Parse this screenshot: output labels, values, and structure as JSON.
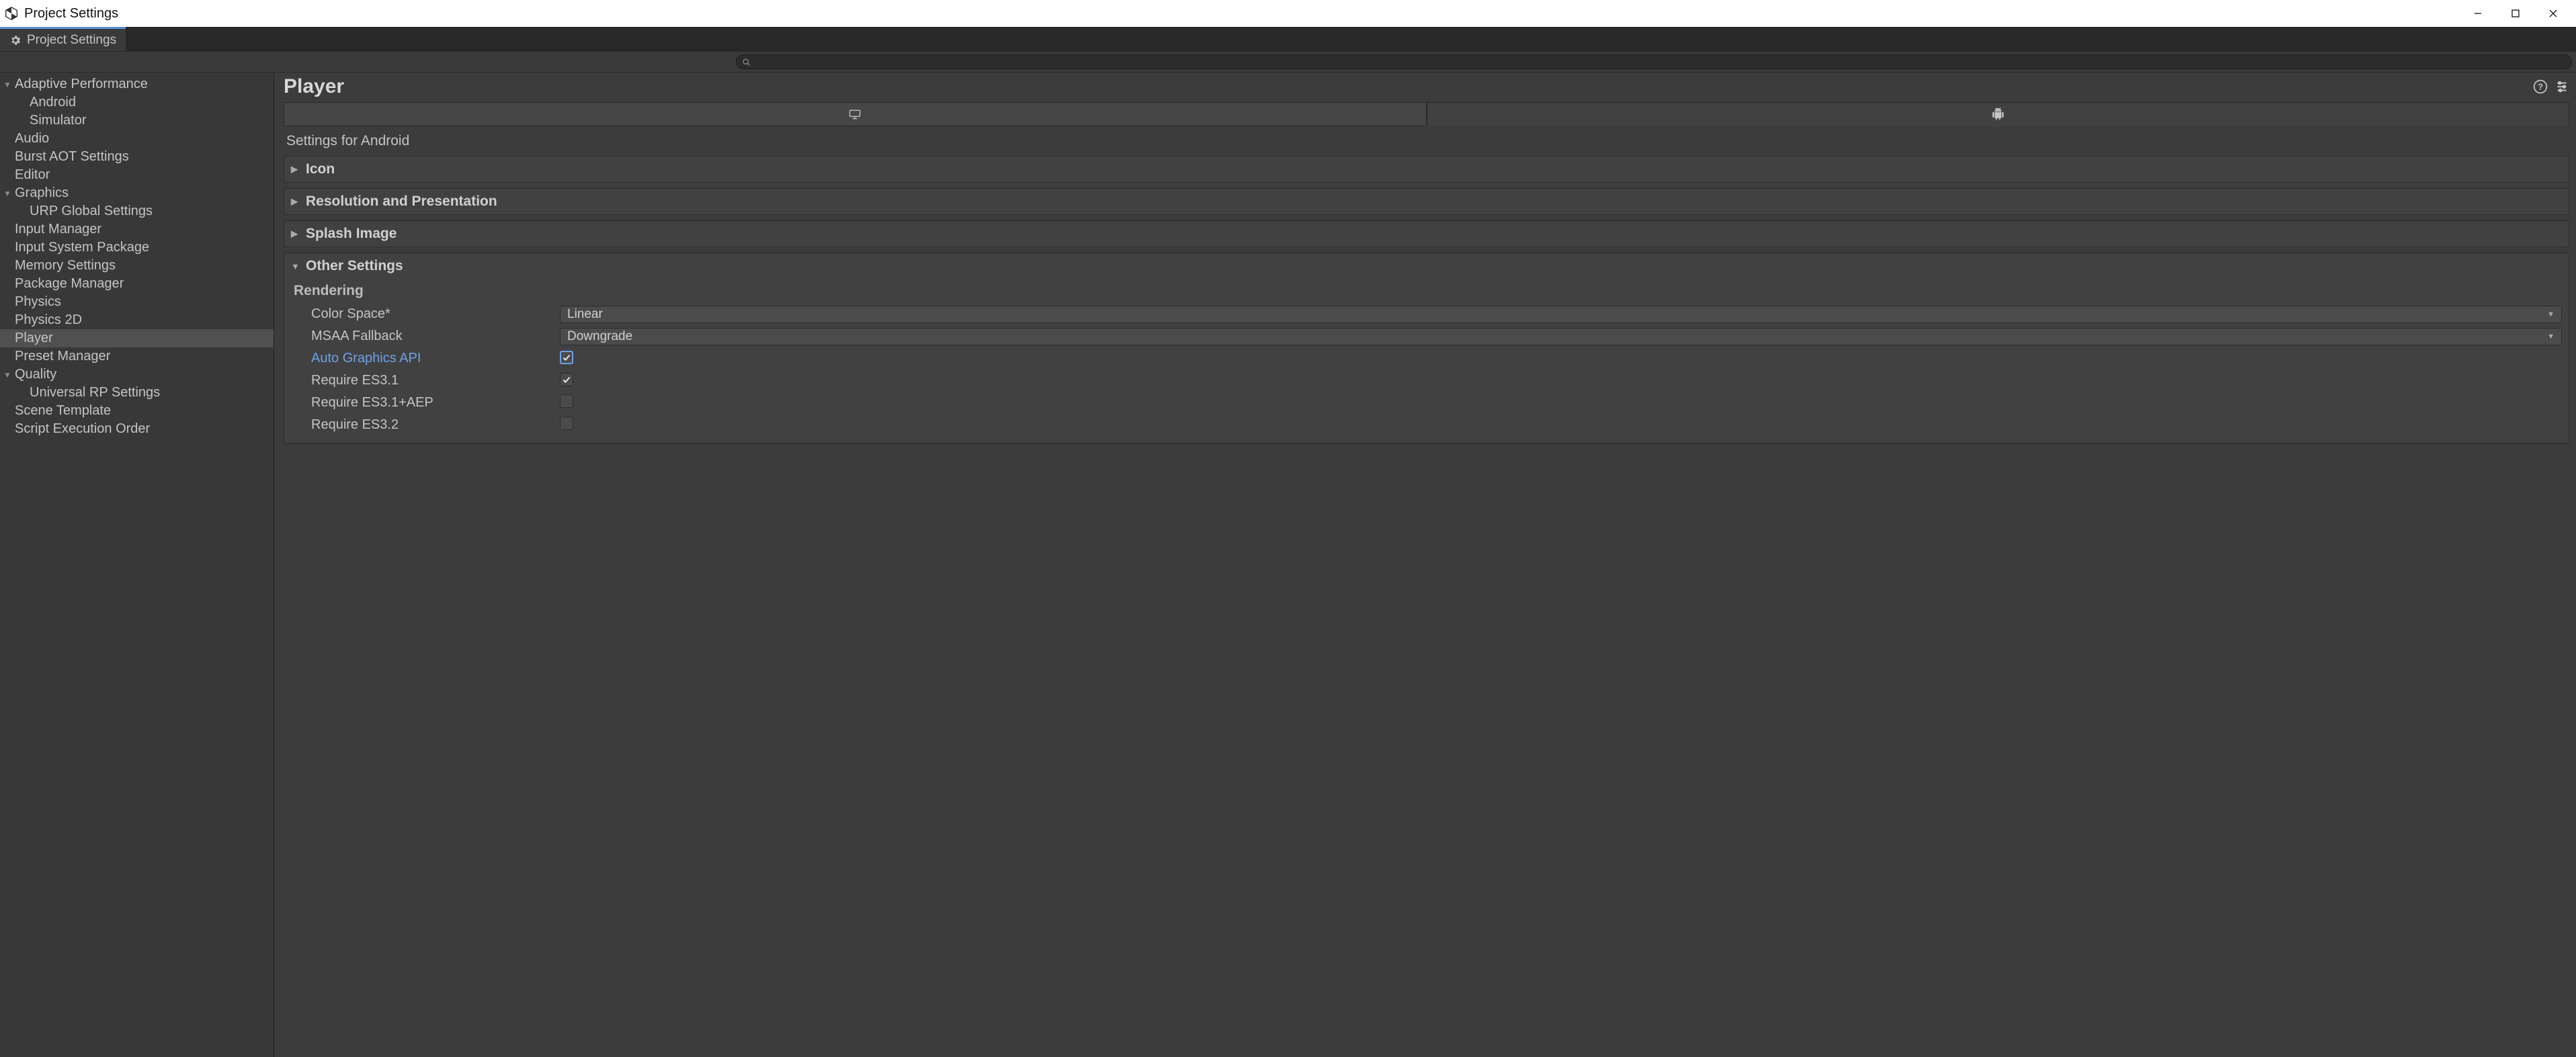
{
  "window": {
    "title": "Project Settings"
  },
  "tab": {
    "label": "Project Settings"
  },
  "search": {
    "placeholder": ""
  },
  "sidebar": {
    "items": [
      {
        "label": "Adaptive Performance",
        "depth": 0,
        "expandable": true,
        "expanded": true,
        "selected": false
      },
      {
        "label": "Android",
        "depth": 1,
        "expandable": false,
        "selected": false
      },
      {
        "label": "Simulator",
        "depth": 1,
        "expandable": false,
        "selected": false
      },
      {
        "label": "Audio",
        "depth": 0,
        "expandable": false,
        "selected": false
      },
      {
        "label": "Burst AOT Settings",
        "depth": 0,
        "expandable": false,
        "selected": false
      },
      {
        "label": "Editor",
        "depth": 0,
        "expandable": false,
        "selected": false
      },
      {
        "label": "Graphics",
        "depth": 0,
        "expandable": true,
        "expanded": true,
        "selected": false
      },
      {
        "label": "URP Global Settings",
        "depth": 1,
        "expandable": false,
        "selected": false
      },
      {
        "label": "Input Manager",
        "depth": 0,
        "expandable": false,
        "selected": false
      },
      {
        "label": "Input System Package",
        "depth": 0,
        "expandable": false,
        "selected": false
      },
      {
        "label": "Memory Settings",
        "depth": 0,
        "expandable": false,
        "selected": false
      },
      {
        "label": "Package Manager",
        "depth": 0,
        "expandable": false,
        "selected": false
      },
      {
        "label": "Physics",
        "depth": 0,
        "expandable": false,
        "selected": false
      },
      {
        "label": "Physics 2D",
        "depth": 0,
        "expandable": false,
        "selected": false
      },
      {
        "label": "Player",
        "depth": 0,
        "expandable": false,
        "selected": true
      },
      {
        "label": "Preset Manager",
        "depth": 0,
        "expandable": false,
        "selected": false
      },
      {
        "label": "Quality",
        "depth": 0,
        "expandable": true,
        "expanded": true,
        "selected": false
      },
      {
        "label": "Universal RP Settings",
        "depth": 1,
        "expandable": false,
        "selected": false
      },
      {
        "label": "Scene Template",
        "depth": 0,
        "expandable": false,
        "selected": false
      },
      {
        "label": "Script Execution Order",
        "depth": 0,
        "expandable": false,
        "selected": false
      }
    ]
  },
  "main": {
    "title": "Player",
    "platformTabs": {
      "pc": "desktop-icon",
      "android": "android-icon",
      "active": "android"
    },
    "subheading": "Settings for Android",
    "foldouts": {
      "icon": {
        "label": "Icon",
        "expanded": false
      },
      "resolution": {
        "label": "Resolution and Presentation",
        "expanded": false
      },
      "splash": {
        "label": "Splash Image",
        "expanded": false
      },
      "other": {
        "label": "Other Settings",
        "expanded": true
      }
    },
    "other": {
      "sectionLabel": "Rendering",
      "rows": {
        "colorSpace": {
          "label": "Color Space*",
          "value": "Linear",
          "type": "dropdown"
        },
        "msaaFallback": {
          "label": "MSAA Fallback",
          "value": "Downgrade",
          "type": "dropdown"
        },
        "autoGraphics": {
          "label": "Auto Graphics API",
          "checked": true,
          "type": "checkbox",
          "highlight": true,
          "accent": true
        },
        "requireES31": {
          "label": "Require ES3.1",
          "checked": true,
          "type": "checkbox"
        },
        "requireES31AEP": {
          "label": "Require ES3.1+AEP",
          "checked": false,
          "type": "checkbox"
        },
        "requireES32": {
          "label": "Require ES3.2",
          "checked": false,
          "type": "checkbox"
        }
      }
    }
  }
}
